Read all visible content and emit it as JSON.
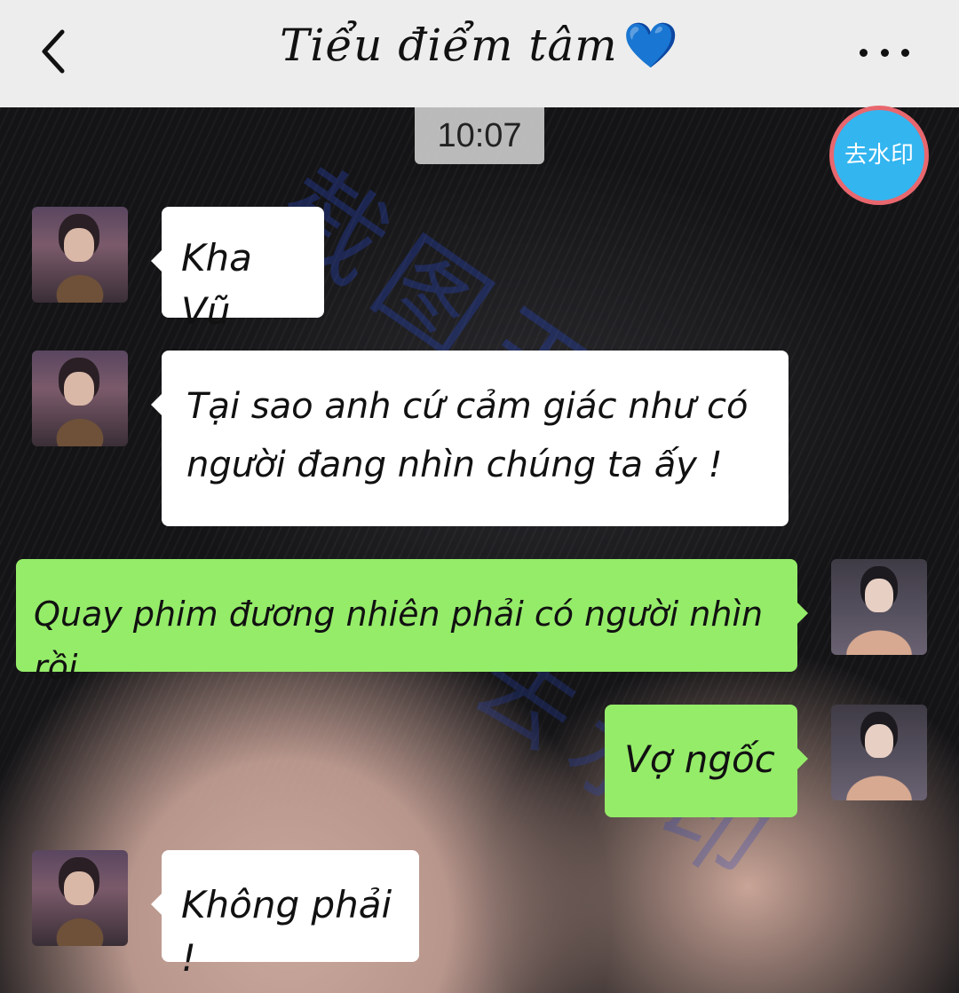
{
  "header": {
    "title": "Tiểu điểm tâm",
    "title_emoji": "💙",
    "back_icon": "chevron-left-icon",
    "more_icon": "more-horizontal-icon"
  },
  "chat": {
    "time_label": "10:07",
    "remove_watermark_label": "去水印",
    "watermark_text_1": "截图王",
    "watermark_text_2": "去水印",
    "messages": [
      {
        "side": "left",
        "text": "Kha Vũ"
      },
      {
        "side": "left",
        "text": "Tại sao anh cứ cảm giác như có\nngười đang nhìn chúng ta ấy !"
      },
      {
        "side": "right",
        "text": "Quay phim đương nhiên phải có người nhìn rồi"
      },
      {
        "side": "right",
        "text": "Vợ ngốc"
      },
      {
        "side": "left",
        "text": "Không phải !"
      }
    ]
  },
  "colors": {
    "header_bg": "#ededed",
    "bubble_left": "#ffffff",
    "bubble_right": "#95ec69",
    "watermark_button": "#33b5f0",
    "watermark_button_border": "#e8676e"
  }
}
